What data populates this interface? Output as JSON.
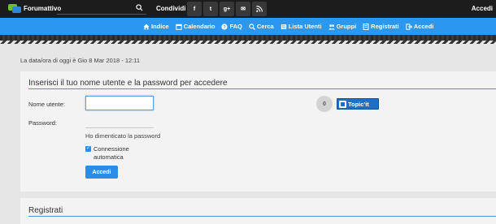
{
  "topbar": {
    "brand": "Forumattivo",
    "share_label": "Condividi :",
    "share_buttons": [
      "f",
      "t",
      "g+",
      "✉",
      "rss"
    ],
    "accedi": "Accedi"
  },
  "nav": {
    "items": [
      {
        "label": "Indice",
        "icon": "home-icon"
      },
      {
        "label": "Calendario",
        "icon": "calendar-icon"
      },
      {
        "label": "FAQ",
        "icon": "help-icon"
      },
      {
        "label": "Cerca",
        "icon": "search-icon"
      },
      {
        "label": "Lista Utenti",
        "icon": "users-icon"
      },
      {
        "label": "Gruppi",
        "icon": "groups-icon"
      },
      {
        "label": "Registrati",
        "icon": "register-icon"
      },
      {
        "label": "Accedi",
        "icon": "login-icon"
      }
    ]
  },
  "date_line": "La data/ora di oggi è Gio 8 Mar 2018 - 12:11",
  "login": {
    "title": "Inserisci il tuo nome utente e la password per accedere",
    "username_label": "Nome utente:",
    "username_value": "",
    "password_label": "Password:",
    "forgot": "Ho dimenticato la password",
    "auto_login": "Connessione automatica",
    "auto_login_checked": true,
    "submit": "Accedi",
    "circle_label": "0",
    "topicit": "Topic'it"
  },
  "register": {
    "title": "Registrati"
  },
  "colors": {
    "nav": "#2b97ee",
    "topbar": "#1c1c1c",
    "accent": "#2b8de8"
  }
}
